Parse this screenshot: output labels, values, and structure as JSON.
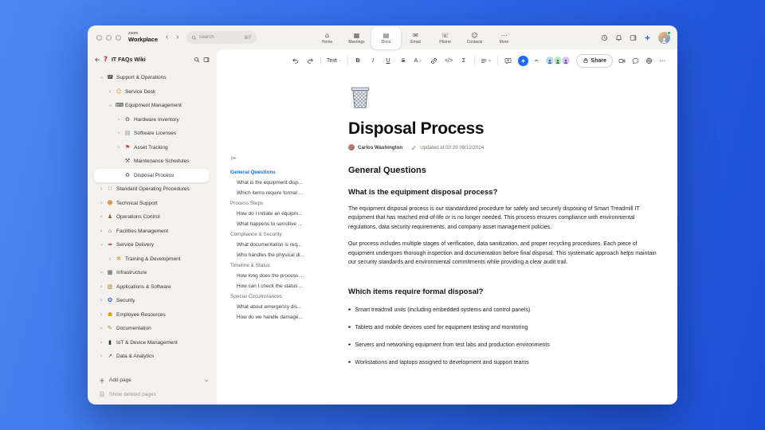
{
  "glyphs": {
    "chevron": "›",
    "nav_back": "‹",
    "nav_forward": "›"
  },
  "titlebar": {
    "logo_small": "zoom",
    "logo_main": "Workplace",
    "search": {
      "placeholder": "Search",
      "shortcut": "⌘F"
    },
    "tabs": [
      {
        "id": "home",
        "label": "Home",
        "glyph": "⌂"
      },
      {
        "id": "meetings",
        "label": "Meetings",
        "glyph": "▦"
      },
      {
        "id": "docs",
        "label": "Docs",
        "glyph": "▤",
        "active": true
      },
      {
        "id": "email",
        "label": "Email",
        "glyph": "✉"
      },
      {
        "id": "phone",
        "label": "Phone",
        "glyph": "☏"
      },
      {
        "id": "contacts",
        "label": "Contacts",
        "glyph": "☺"
      },
      {
        "id": "more",
        "label": "More",
        "glyph": "⋯"
      }
    ]
  },
  "sidebar": {
    "logo_glyph": "?",
    "title": "IT FAQs Wiki",
    "items": [
      {
        "id": "support-operations",
        "label": "Support & Operations",
        "icon": "☎",
        "color": "#3f3f3f",
        "level": 0,
        "chevron": "down"
      },
      {
        "id": "service-desk",
        "label": "Service Desk",
        "icon": "☺",
        "color": "#d98f2b",
        "level": 1,
        "chevron": "right"
      },
      {
        "id": "equipment-management",
        "label": "Equipment Management",
        "icon": "⌨",
        "color": "#33373d",
        "level": 1,
        "chevron": "down"
      },
      {
        "id": "hardware-inventory",
        "label": "Hardware Inventory",
        "icon": "⚙",
        "color": "#4c4f54",
        "level": 2,
        "chevron": "right"
      },
      {
        "id": "software-licenses",
        "label": "Software Licenses",
        "icon": "▤",
        "color": "#7d8a9c",
        "level": 2,
        "chevron": "right"
      },
      {
        "id": "asset-tracking",
        "label": "Asset Tracking",
        "icon": "⚑",
        "color": "#e03131",
        "level": 2,
        "chevron": "right"
      },
      {
        "id": "maintenance-schedules",
        "label": "Maintenance Schedules",
        "icon": "⚒",
        "color": "#4c4f54",
        "level": 2,
        "chevron": "none"
      },
      {
        "id": "disposal-process",
        "label": "Disposal Process",
        "icon": "♻",
        "color": "#5c6b7a",
        "level": 2,
        "chevron": "none",
        "selected": true
      },
      {
        "id": "standard-operating-procedures",
        "label": "Standard Operating Procedures",
        "icon": "∷",
        "color": "#4c4f54",
        "level": 0,
        "chevron": "right"
      },
      {
        "id": "technical-support",
        "label": "Technical Support",
        "icon": "☻",
        "color": "#d98f2b",
        "level": 0,
        "chevron": "right"
      },
      {
        "id": "operations-control",
        "label": "Operations Control",
        "icon": "♟",
        "color": "#8a6d1f",
        "level": 0,
        "chevron": "right"
      },
      {
        "id": "facilities-management",
        "label": "Facilities Management",
        "icon": "⌂",
        "color": "#8d939c",
        "level": 0,
        "chevron": "right"
      },
      {
        "id": "service-delivery",
        "label": "Service Delivery",
        "icon": "➠",
        "color": "#c0392b",
        "level": 0,
        "chevron": "down"
      },
      {
        "id": "training-development",
        "label": "Training & Development",
        "icon": "✻",
        "color": "#d98f2b",
        "level": 1,
        "chevron": "right"
      },
      {
        "id": "infrastructure",
        "label": "Infrastructure",
        "icon": "▦",
        "color": "#474c53",
        "level": 0,
        "chevron": "right"
      },
      {
        "id": "applications-software",
        "label": "Applications & Software",
        "icon": "▥",
        "color": "#b3702c",
        "level": 0,
        "chevron": "right"
      },
      {
        "id": "security",
        "label": "Security",
        "icon": "✪",
        "color": "#2b5bd7",
        "level": 0,
        "chevron": "right"
      },
      {
        "id": "employee-resources",
        "label": "Employee Resources",
        "icon": "☗",
        "color": "#d9a514",
        "level": 0,
        "chevron": "right"
      },
      {
        "id": "documentation",
        "label": "Documentation",
        "icon": "✎",
        "color": "#b07c2a",
        "level": 0,
        "chevron": "right"
      },
      {
        "id": "iot-device-management",
        "label": "IoT & Device Management",
        "icon": "▮",
        "color": "#33373d",
        "level": 0,
        "chevron": "right"
      },
      {
        "id": "data-analytics",
        "label": "Data & Analytics",
        "icon": "↗",
        "color": "#d0342c",
        "level": 0,
        "chevron": "right"
      }
    ],
    "add_page": "Add page",
    "show_deleted": "Show deleted pages"
  },
  "toolbar": {
    "text_style": "Text",
    "bold": "B",
    "italic": "I",
    "underline": "U",
    "strike": "S",
    "color": "A",
    "code": "</>",
    "equation": "Σ",
    "share": "Share",
    "more": "⋯"
  },
  "outline": {
    "items": [
      {
        "id": "general-questions",
        "label": "General Questions",
        "type": "section",
        "active": true
      },
      {
        "id": "q-what-is-disposal",
        "label": "What is the equipment disp...",
        "type": "item"
      },
      {
        "id": "q-which-items",
        "label": "Which items require formal ...",
        "type": "item"
      },
      {
        "id": "process-steps",
        "label": "Process Steps",
        "type": "section"
      },
      {
        "id": "q-how-initiate",
        "label": "How do I initiate an equipm...",
        "type": "item"
      },
      {
        "id": "q-sensitive-data",
        "label": "What happens to sensitive ...",
        "type": "item"
      },
      {
        "id": "compliance-security",
        "label": "Compliance & Security",
        "type": "section"
      },
      {
        "id": "q-documentation-required",
        "label": "What documentation is req...",
        "type": "item"
      },
      {
        "id": "q-physical-disposal",
        "label": "Who handles the physical di...",
        "type": "item"
      },
      {
        "id": "timeline-status",
        "label": "Timeline & Status",
        "type": "section"
      },
      {
        "id": "q-how-long",
        "label": "How long does the process ...",
        "type": "item"
      },
      {
        "id": "q-check-status",
        "label": "How can I check the status ...",
        "type": "item"
      },
      {
        "id": "special-circumstances",
        "label": "Special Circumstances",
        "type": "section"
      },
      {
        "id": "q-emergency",
        "label": "What about emergency dis...",
        "type": "item"
      },
      {
        "id": "q-damage",
        "label": "How do we handle damage...",
        "type": "item"
      }
    ]
  },
  "doc": {
    "title": "Disposal Process",
    "author": "Carlos Washington",
    "updated": "Updated at 00:39 09/12/2024",
    "section_h1": "General Questions",
    "q1_heading": "What is the equipment disposal process?",
    "q1_p1": "The equipment disposal process is our standardized procedure for safely and securely disposing of Smart Treadmill IT equipment that has reached end-of-life or is no longer needed. This process ensures compliance with environmental regulations, data security requirements, and company asset management policies.",
    "q1_p2": "Our process includes multiple stages of verification, data sanitization, and proper recycling procedures. Each piece of equipment undergoes thorough inspection and documentation before final disposal. This systematic approach helps maintain our security standards and environmental commitments while providing a clear audit trail.",
    "q2_heading": "Which items require formal disposal?",
    "q2_bullets": [
      {
        "id": "bullet-treadmills",
        "label": "Smart treadmill units (including embedded systems and control panels)"
      },
      {
        "id": "bullet-tablets",
        "label": "Tablets and mobile devices used for equipment testing and monitoring"
      },
      {
        "id": "bullet-servers",
        "label": "Servers and networking equipment from test labs and production environments"
      },
      {
        "id": "bullet-workstations",
        "label": "Workstations and laptops assigned to development and support teams"
      }
    ]
  }
}
